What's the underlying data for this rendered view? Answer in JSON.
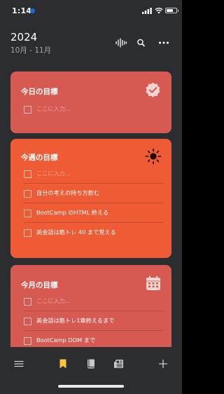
{
  "status_bar": {
    "time": "1:14"
  },
  "header": {
    "year": "2024",
    "range": "10月 - 11月"
  },
  "colors": {
    "background": "#2b2d31",
    "daily_card": "#d65a52",
    "weekly_card": "#ee5b34",
    "monthly_card": "#d65a52",
    "active_tab": "#f6c443"
  },
  "cards": [
    {
      "title": "今日の目標",
      "icon": "verified-badge-icon",
      "items": [
        {
          "text": "ここに入力...",
          "placeholder": true
        }
      ]
    },
    {
      "title": "今週の目標",
      "icon": "sun-icon",
      "items": [
        {
          "text": "ここに入力...",
          "placeholder": true
        },
        {
          "text": "自分の考えの持ち方飲む",
          "placeholder": false
        },
        {
          "text": "BootCamp のHTML 終える",
          "placeholder": false
        },
        {
          "text": "英会話は筋トレ 40 まで覚える",
          "placeholder": false
        }
      ]
    },
    {
      "title": "今月の目標",
      "icon": "calendar-icon",
      "items": [
        {
          "text": "ここに入力...",
          "placeholder": true
        },
        {
          "text": "英会話は筋トレ1章終えるまで",
          "placeholder": false
        },
        {
          "text": "BootCamp DOM まで",
          "placeholder": false
        }
      ]
    }
  ],
  "tabbar": {
    "tabs": [
      "menu-icon",
      "bookmark-icon",
      "book-icon",
      "newspaper-icon",
      "plus-icon"
    ],
    "active": "bookmark-icon"
  }
}
